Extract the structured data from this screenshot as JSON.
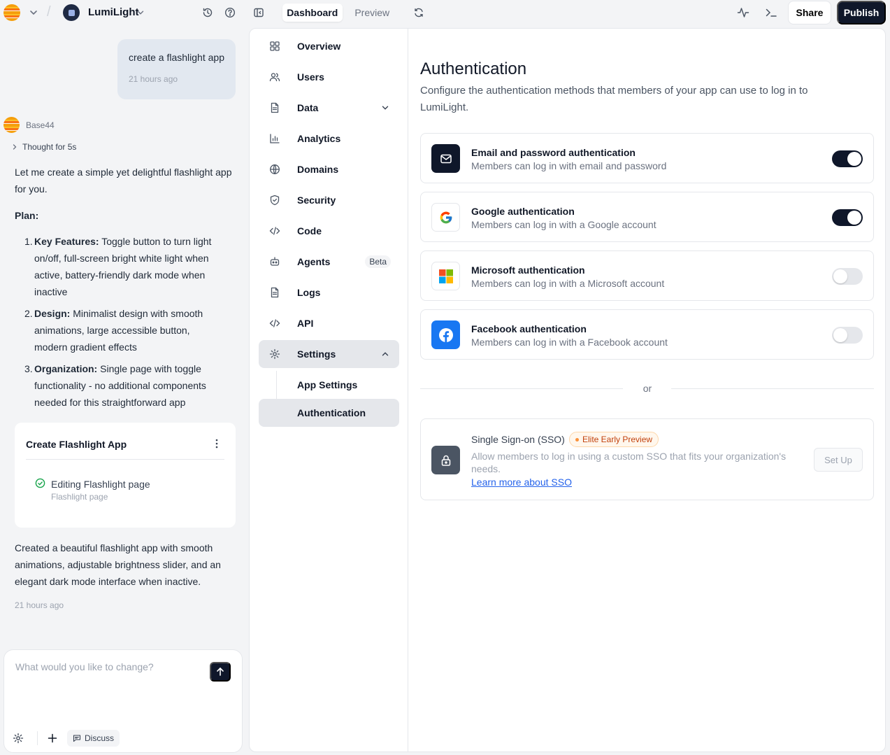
{
  "topbar": {
    "app_name": "LumiLight",
    "tabs": [
      {
        "label": "Dashboard",
        "active": true
      },
      {
        "label": "Preview",
        "active": false
      }
    ],
    "share_label": "Share",
    "publish_label": "Publish"
  },
  "chat": {
    "user_message": "create a flashlight app",
    "user_time": "21 hours ago",
    "bot_name": "Base44",
    "thought": "Thought for 5s",
    "intro": "Let me create a simple yet delightful flashlight app for you.",
    "plan_heading": "Plan:",
    "plan": [
      {
        "num": "1.",
        "title": "Key Features:",
        "text": " Toggle button to turn light on/off, full-screen bright white light when active, battery-friendly dark mode when inactive"
      },
      {
        "num": "2.",
        "title": "Design:",
        "text": " Minimalist design with smooth animations, large accessible button, modern gradient effects"
      },
      {
        "num": "3.",
        "title": "Organization:",
        "text": " Single page with toggle functionality - no additional components needed for this straightforward app"
      }
    ],
    "task_card": {
      "title": "Create Flashlight App",
      "step": "Editing Flashlight page",
      "step_sub": "Flashlight page"
    },
    "summary": "Created a beautiful flashlight app with smooth animations, adjustable brightness slider, and an elegant dark mode interface when inactive.",
    "summary_time": "21 hours ago",
    "composer_placeholder": "What would you like to change?",
    "discuss_label": "Discuss"
  },
  "nav": {
    "items": [
      {
        "label": "Overview"
      },
      {
        "label": "Users"
      },
      {
        "label": "Data"
      },
      {
        "label": "Analytics"
      },
      {
        "label": "Domains"
      },
      {
        "label": "Security"
      },
      {
        "label": "Code"
      },
      {
        "label": "Agents",
        "badge": "Beta"
      },
      {
        "label": "Logs"
      },
      {
        "label": "API"
      },
      {
        "label": "Settings"
      },
      {
        "label": "App Settings"
      },
      {
        "label": "Authentication"
      }
    ]
  },
  "auth": {
    "title": "Authentication",
    "description": "Configure the authentication methods that members of your app can use to log in to LumiLight.",
    "methods": [
      {
        "title": "Email and password authentication",
        "subtitle": "Members can log in with email and password",
        "enabled": true
      },
      {
        "title": "Google authentication",
        "subtitle": "Members can log in with a Google account",
        "enabled": true
      },
      {
        "title": "Microsoft authentication",
        "subtitle": "Members can log in with a Microsoft account",
        "enabled": false
      },
      {
        "title": "Facebook authentication",
        "subtitle": "Members can log in with a Facebook account",
        "enabled": false
      }
    ],
    "or_label": "or",
    "sso": {
      "title": "Single Sign-on (SSO)",
      "badge": "Elite Early Preview",
      "description": "Allow members to log in using a custom SSO that fits your organization's needs.",
      "link": "Learn more about SSO",
      "button": "Set Up"
    }
  },
  "colors": {
    "primary_dark": "#0f172a",
    "link": "#2563eb",
    "badge_orange": "#c2410c",
    "facebook": "#1877f2"
  }
}
